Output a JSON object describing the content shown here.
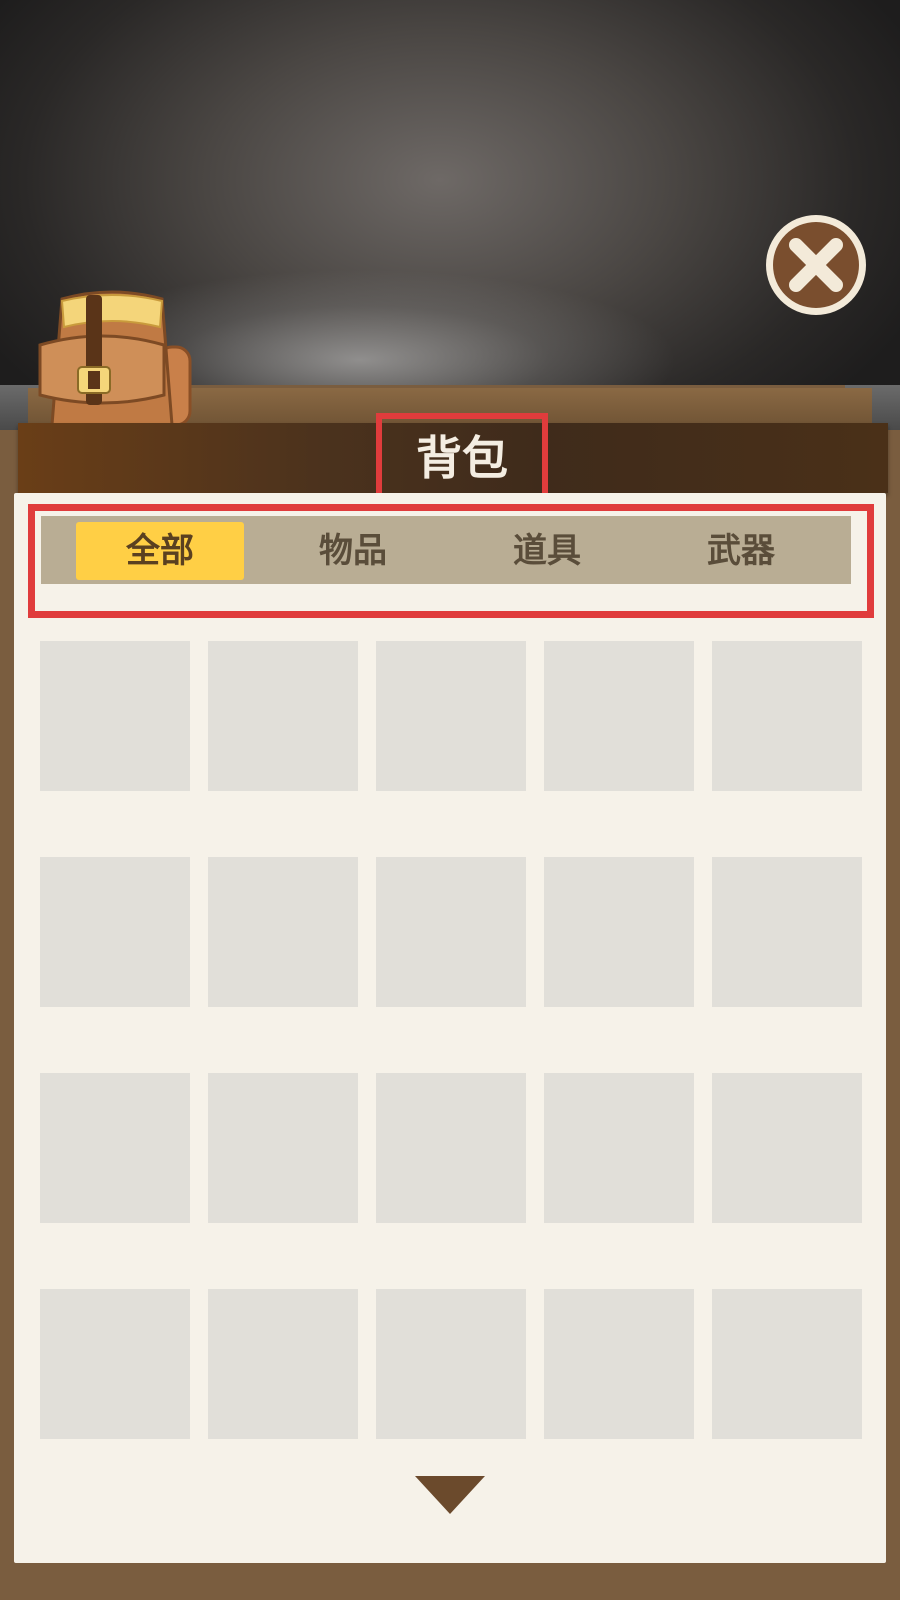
{
  "header": {
    "title": "背包"
  },
  "tabs": [
    {
      "label": "全部",
      "active": true
    },
    {
      "label": "物品",
      "active": false
    },
    {
      "label": "道具",
      "active": false
    },
    {
      "label": "武器",
      "active": false
    }
  ],
  "inventory": {
    "columns": 5,
    "visible_rows": 4,
    "slots_filled": 0
  },
  "icons": {
    "close": "close-icon",
    "backpack": "backpack-icon",
    "scroll_more": "triangle-down-icon"
  },
  "colors": {
    "active_tab": "#ffcf45",
    "tab_bar": "#b9ad94",
    "header_bar": "#4b321d",
    "paper": "#f6f2e9",
    "slot": "#e1dfd9",
    "highlight": "#e03c3c"
  }
}
